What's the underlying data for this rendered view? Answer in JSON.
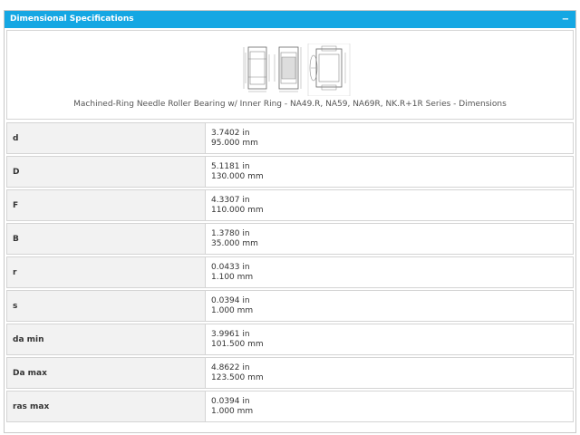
{
  "panel": {
    "title": "Dimensional Specifications",
    "collapse_symbol": "−"
  },
  "figure": {
    "caption": "Machined-Ring Needle Roller Bearing w/ Inner Ring - NA49.R, NA59, NA69R, NK.R+1R Series - Dimensions",
    "icon": "bearing-cross-section-drawing"
  },
  "specs": [
    {
      "label": "d",
      "inch": "3.7402 in",
      "mm": "95.000 mm"
    },
    {
      "label": "D",
      "inch": "5.1181 in",
      "mm": "130.000 mm"
    },
    {
      "label": "F",
      "inch": "4.3307 in",
      "mm": "110.000 mm"
    },
    {
      "label": "B",
      "inch": "1.3780 in",
      "mm": "35.000 mm"
    },
    {
      "label": "r",
      "inch": "0.0433 in",
      "mm": "1.100 mm"
    },
    {
      "label": "s",
      "inch": "0.0394 in",
      "mm": "1.000 mm"
    },
    {
      "label": "da min",
      "inch": "3.9961 in",
      "mm": "101.500 mm"
    },
    {
      "label": "Da max",
      "inch": "4.8622 in",
      "mm": "123.500 mm"
    },
    {
      "label": "ras max",
      "inch": "0.0394 in",
      "mm": "1.000 mm"
    }
  ]
}
